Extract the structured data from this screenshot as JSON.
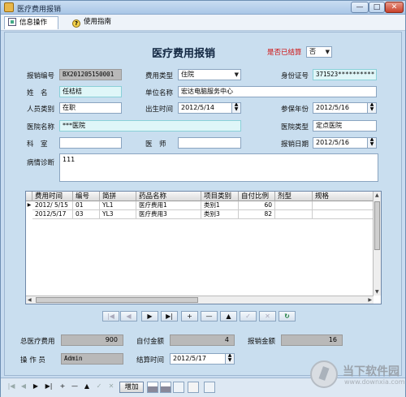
{
  "window": {
    "title": "医疗费用报销",
    "minimize": "—",
    "maximize": "□",
    "close": "✕"
  },
  "menu": {
    "tab_info": "信息操作",
    "tab_guide": "使用指南"
  },
  "form": {
    "title": "医疗费用报销",
    "settled_label": "是否已结算",
    "settled_value": "否",
    "claim_no_label": "报销编号",
    "claim_no": "BX201205150001",
    "fee_type_label": "费用类型",
    "fee_type": "住院",
    "id_no_label": "身份证号",
    "id_no": "371523**********",
    "name_label": "姓　名",
    "name": "任桔桔",
    "employer_label": "单位名称",
    "employer": "宏达电脑服务中心",
    "staff_type_label": "人员类别",
    "staff_type": "在职",
    "birth_label": "出生时间",
    "birth": "2012/5/14",
    "insured_label": "参保年份",
    "insured": "2012/5/16",
    "hospital_label": "医院名称",
    "hospital": "***医院",
    "hospital_type_label": "医院类型",
    "hospital_type": "定点医院",
    "dept_label": "科　室",
    "dept": "",
    "doctor_label": "医　师",
    "doctor": "",
    "claim_date_label": "报销日期",
    "claim_date": "2012/5/16",
    "diagnosis_label": "病情诊断",
    "diagnosis": "111"
  },
  "grid": {
    "columns": [
      "费用时间",
      "编号",
      "简拼",
      "药品名称",
      "项目类别",
      "自付比例",
      "剂型",
      "规格"
    ],
    "rows": [
      {
        "indicator": "▶",
        "time": "2012/ 5/15",
        "code": "01",
        "abbr": "YL1",
        "drug": "医疗费用1",
        "category": "类别1",
        "ratio": "60",
        "form": "",
        "spec": ""
      },
      {
        "indicator": "",
        "time": "2012/5/17",
        "code": "03",
        "abbr": "YL3",
        "drug": "医疗费用3",
        "category": "类别3",
        "ratio": "82",
        "form": "",
        "spec": ""
      }
    ]
  },
  "nav": {
    "first": "|◀",
    "prev": "◀",
    "next": "▶",
    "last": "▶|",
    "insert": "+",
    "delete": "—",
    "edit": "▲",
    "post": "✓",
    "cancel": "✕",
    "refresh": "↻"
  },
  "summary": {
    "total_label": "总医疗费用",
    "total": "900",
    "self_pay_label": "自付金额",
    "self_pay": "4",
    "reimb_label": "报销金额",
    "reimb": "16",
    "operator_label": "操 作 员",
    "operator": "Admin",
    "settle_time_label": "结算时间",
    "settle_time": "2012/5/17"
  },
  "bottom": {
    "nav_first": "|◀",
    "nav_prev": "◀",
    "nav_next": "▶",
    "nav_last": "▶|",
    "nav_insert": "+",
    "nav_delete": "—",
    "nav_edit": "▲",
    "nav_post": "✓",
    "nav_cancel": "✕",
    "add_label": "增加"
  },
  "watermark": {
    "text": "当下软件园",
    "url": "www.downxia.com"
  }
}
